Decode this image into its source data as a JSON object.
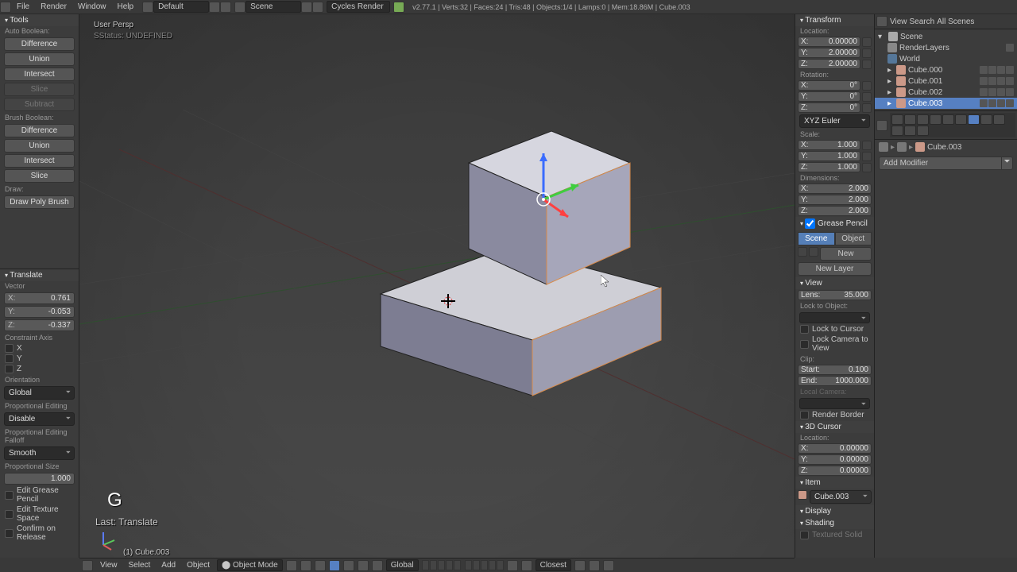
{
  "topmenu": {
    "file": "File",
    "render": "Render",
    "window": "Window",
    "help": "Help"
  },
  "layout_dd": "Default",
  "scene_dd": "Scene",
  "engine_dd": "Cycles Render",
  "stats": "v2.77.1 | Verts:32 | Faces:24 | Tris:48 | Objects:1/4 | Lamps:0 | Mem:18.86M | Cube.003",
  "tools": {
    "header": "Tools",
    "auto_boolean": "Auto Boolean:",
    "diff": "Difference",
    "union": "Union",
    "intersect": "Intersect",
    "slice": "Slice",
    "subtract": "Subtract",
    "brush_boolean": "Brush Boolean:",
    "draw_hdr": "Draw:",
    "draw_poly": "Draw Poly Brush"
  },
  "operator": {
    "header": "Translate",
    "vector": "Vector",
    "x": "0.761",
    "y": "-0.053",
    "z": "-0.337",
    "constraint": "Constraint Axis",
    "cx": "X",
    "cy": "Y",
    "cz": "Z",
    "orientation": "Orientation",
    "orientation_val": "Global",
    "prop_edit": "Proportional Editing",
    "prop_edit_val": "Disable",
    "prop_falloff": "Proportional Editing Falloff",
    "prop_falloff_val": "Smooth",
    "prop_size": "Proportional Size",
    "prop_size_val": "1.000",
    "edit_gp": "Edit Grease Pencil",
    "edit_tex": "Edit Texture Space",
    "confirm": "Confirm on Release"
  },
  "viewport": {
    "persp": "User Persp",
    "sstatus": "SStatus: UNDEFINED",
    "big_key": "G",
    "last_op": "Last: Translate",
    "sel_obj": "(1) Cube.003"
  },
  "bottom": {
    "view": "View",
    "select": "Select",
    "add": "Add",
    "object": "Object",
    "mode": "Object Mode",
    "orientation": "Global",
    "snap": "Closest"
  },
  "npanel": {
    "transform": "Transform",
    "location": "Location:",
    "loc": {
      "x": "0.00000",
      "y": "2.00000",
      "z": "2.00000"
    },
    "rotation": "Rotation:",
    "rot": {
      "x": "0°",
      "y": "0°",
      "z": "0°"
    },
    "rot_mode": "XYZ Euler",
    "scale": "Scale:",
    "scl": {
      "x": "1.000",
      "y": "1.000",
      "z": "1.000"
    },
    "dimensions": "Dimensions:",
    "dim": {
      "x": "2.000",
      "y": "2.000",
      "z": "2.000"
    },
    "gp": "Grease Pencil",
    "gp_scene": "Scene",
    "gp_object": "Object",
    "gp_new": "New",
    "gp_new_layer": "New Layer",
    "view": "View",
    "lens": "Lens:",
    "lens_val": "35.000",
    "lock_obj": "Lock to Object:",
    "lock_cursor": "Lock to Cursor",
    "lock_cam": "Lock Camera to View",
    "clip": "Clip:",
    "clip_start": "Start:",
    "clip_start_val": "0.100",
    "clip_end": "End:",
    "clip_end_val": "1000.000",
    "local_cam": "Local Camera:",
    "render_border": "Render Border",
    "cursor_3d": "3D Cursor",
    "cursor_loc": "Location:",
    "cur": {
      "x": "0.00000",
      "y": "0.00000",
      "z": "0.00000"
    },
    "item": "Item",
    "item_name": "Cube.003",
    "display": "Display",
    "shading": "Shading",
    "textured": "Textured Solid"
  },
  "outliner": {
    "view": "View",
    "search": "Search",
    "all_scenes": "All Scenes",
    "scene": "Scene",
    "render_layers": "RenderLayers",
    "world": "World",
    "cubes": [
      "Cube.000",
      "Cube.001",
      "Cube.002",
      "Cube.003"
    ]
  },
  "props": {
    "obj": "Cube.003",
    "add_modifier": "Add Modifier"
  }
}
